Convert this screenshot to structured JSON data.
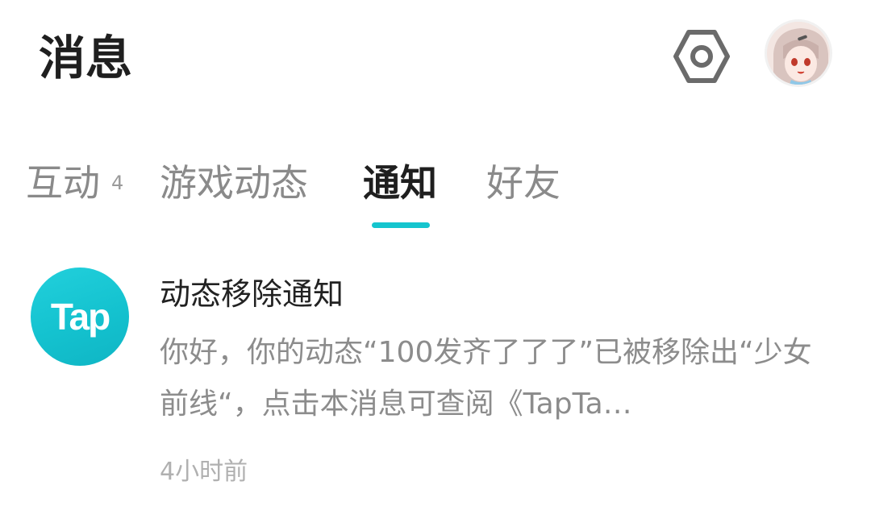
{
  "header": {
    "title": "消息",
    "settings_icon": "hexagon-gear-icon",
    "avatar_icon": "user-avatar"
  },
  "tabs": [
    {
      "label": "互动",
      "badge": "4",
      "active": false
    },
    {
      "label": "游戏动态",
      "badge": "",
      "active": false
    },
    {
      "label": "通知",
      "badge": "",
      "active": true
    },
    {
      "label": "好友",
      "badge": "",
      "active": false
    }
  ],
  "accent_color": "#15c5ce",
  "notification": {
    "logo_text": "Tap",
    "title": "动态移除通知",
    "body": "你好，你的动态“100发齐了了了”已被移除出“少女前线“，点击本消息可查阅《TapTa…",
    "time": "4小时前"
  }
}
